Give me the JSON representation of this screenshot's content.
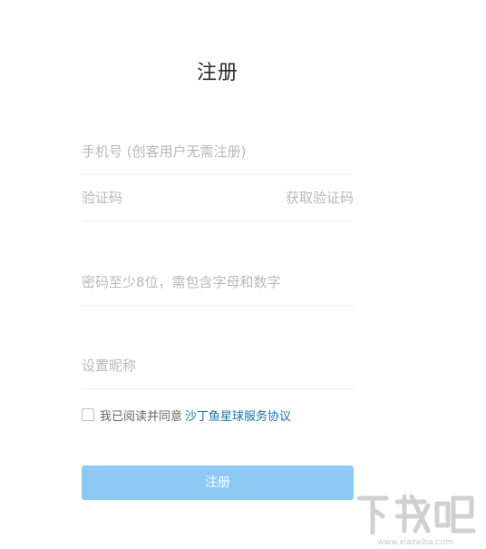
{
  "page": {
    "title": "注册"
  },
  "form": {
    "phone_placeholder": "手机号 (创客用户无需注册)",
    "code_placeholder": "验证码",
    "get_code_label": "获取验证码",
    "password_placeholder": "密码至少8位，需包含字母和数字",
    "nickname_placeholder": "设置昵称",
    "agree_text": "我已阅读并同意",
    "agree_link": "沙丁鱼星球服务协议",
    "submit_label": "注册"
  },
  "watermark": {
    "brand": "下载吧",
    "url": "www.xiazaiba.com"
  },
  "colors": {
    "accent_button": "#8ccaf5",
    "link": "#1a73a8"
  }
}
